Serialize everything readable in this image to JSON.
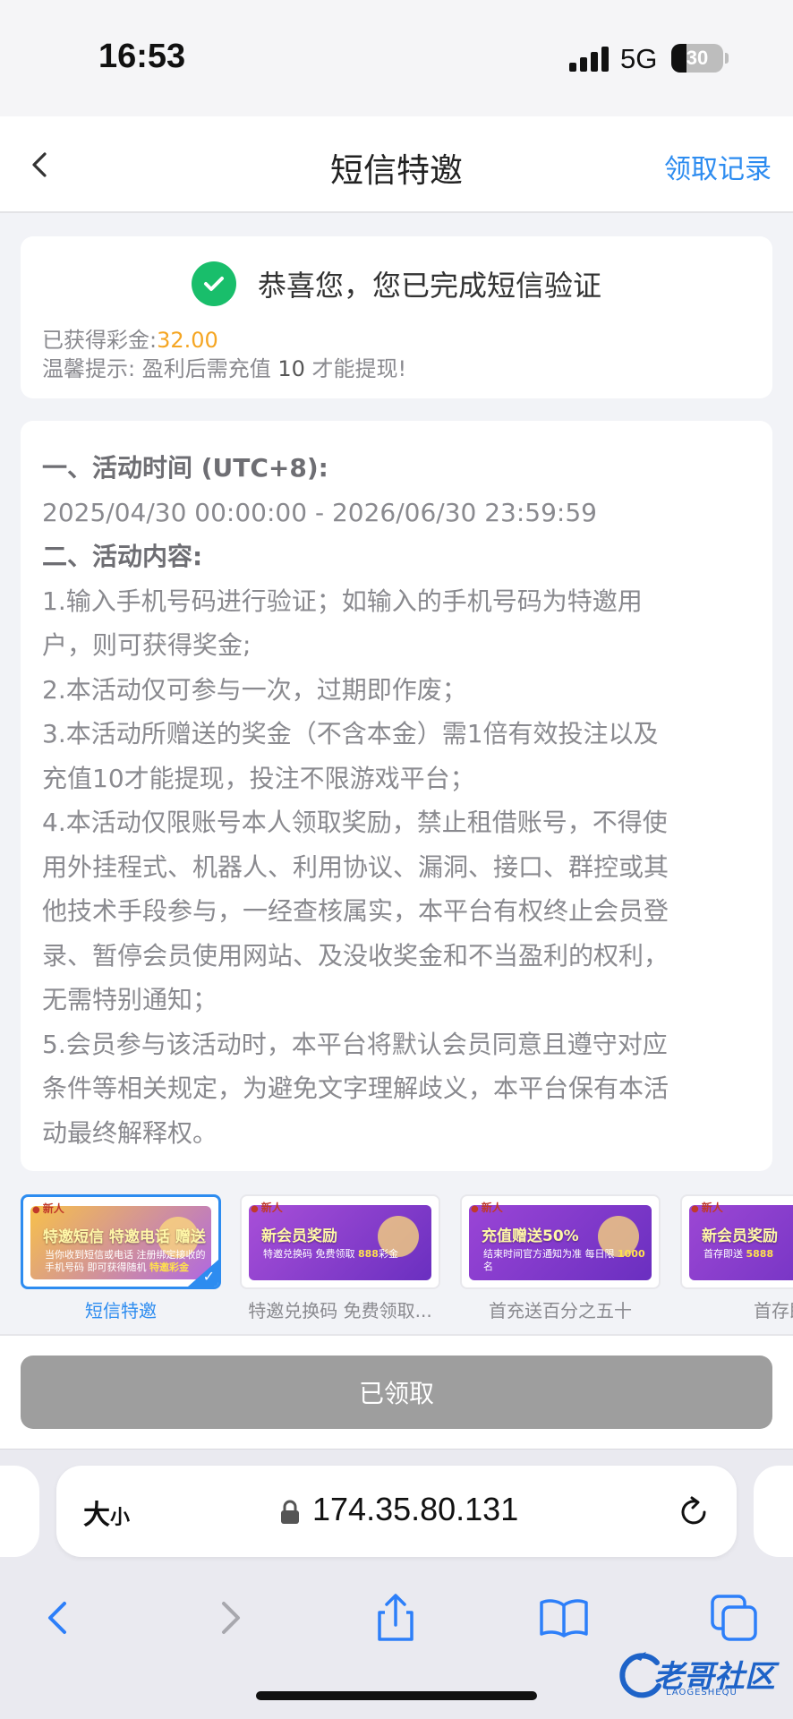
{
  "status_bar": {
    "time": "16:53",
    "network": "5G",
    "battery": "30",
    "battery_level": 0.3
  },
  "header": {
    "title": "短信特邀",
    "right_link": "领取记录"
  },
  "success_card": {
    "message": "恭喜您，您已完成短信验证",
    "bonus_label": "已获得彩金:",
    "bonus_value": "32.00",
    "tip_prefix": "温馨提示: 盈利后需充值 ",
    "tip_amount": "10",
    "tip_suffix": " 才能提现!"
  },
  "rules": {
    "lines": [
      {
        "text": "一、活动时间 (UTC+8):",
        "head": true
      },
      {
        "text": "2025/04/30 00:00:00 - 2026/06/30 23:59:59",
        "head": false
      },
      {
        "text": "二、活动内容:",
        "head": true
      },
      {
        "text": "1.输入手机号码进行验证；如输入的手机号码为特邀用",
        "head": false
      },
      {
        "text": "户，则可获得奖金;",
        "head": false
      },
      {
        "text": "2.本活动仅可参与一次，过期即作废；",
        "head": false
      },
      {
        "text": "3.本活动所赠送的奖金（不含本金）需1倍有效投注以及",
        "head": false
      },
      {
        "text": "充值10才能提现，投注不限游戏平台；",
        "head": false
      },
      {
        "text": "4.本活动仅限账号本人领取奖励，禁止租借账号，不得使",
        "head": false
      },
      {
        "text": "用外挂程式、机器人、利用协议、漏洞、接口、群控或其",
        "head": false
      },
      {
        "text": "他技术手段参与，一经查核属实，本平台有权终止会员登",
        "head": false
      },
      {
        "text": "录、暂停会员使用网站、及没收奖金和不当盈利的权利，",
        "head": false
      },
      {
        "text": "无需特别通知；",
        "head": false
      },
      {
        "text": "5.会员参与该活动时，本平台将默认会员同意且遵守对应",
        "head": false
      },
      {
        "text": "条件等相关规定，为避免文字理解歧义，本平台保有本活",
        "head": false
      },
      {
        "text": "动最终解释权。",
        "head": false
      }
    ]
  },
  "promotions": [
    {
      "caption": "短信特邀",
      "tag": "新人",
      "banner_title": "特邀短信 特邀电话 赠送",
      "banner_sub": "当你收到短信或电话 注册绑定接收的手机号码 即可获得随机",
      "banner_highlight": "特邀彩金",
      "selected": true,
      "bg": "#f0a93a"
    },
    {
      "caption": "特邀兑换码 免费领取...",
      "tag": "新人",
      "banner_title": "新会员奖励",
      "banner_sub": "特邀兑换码 免费领取",
      "banner_highlight": "888",
      "banner_unit": "彩金",
      "selected": false,
      "bg": "#a84fd8"
    },
    {
      "caption": "首充送百分之五十",
      "tag": "新人",
      "banner_title": "充值赠送50%",
      "banner_sub": "结束时间官方通知为准 每日限",
      "banner_highlight": "1000",
      "banner_unit": "名",
      "selected": false,
      "bg": "#9a45d6"
    },
    {
      "caption": "首存即",
      "tag": "新人",
      "banner_title": "新会员奖励",
      "banner_sub": "首存即送",
      "banner_highlight": "5888",
      "selected": false,
      "bg": "#9c47d4"
    }
  ],
  "claim_button": {
    "label": "已领取"
  },
  "browser": {
    "text_size_big": "大",
    "text_size_small": "小",
    "url": "174.35.80.131"
  },
  "watermark": {
    "text": "老哥社区",
    "sub": "LAOGESHEQU"
  }
}
